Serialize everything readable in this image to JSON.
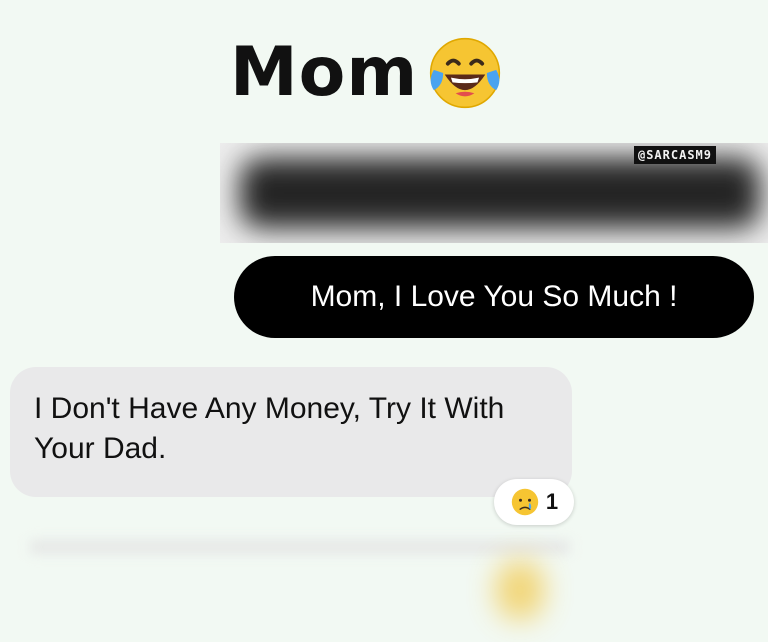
{
  "header": {
    "title": "Mom",
    "title_emoji": "face-with-tears-of-joy-icon"
  },
  "watermark": {
    "text": "@SARCASM9"
  },
  "messages": [
    {
      "direction": "outgoing",
      "text": "Mom, I Love You So Much !",
      "bubble_color": "#000000",
      "text_color": "#ffffff"
    },
    {
      "direction": "incoming",
      "text": "I Don't Have Any Money, Try It With Your Dad.",
      "bubble_color": "#e9e9ea",
      "text_color": "#111111",
      "reaction": {
        "emoji": "crying-face-icon",
        "count": "1"
      }
    }
  ],
  "colors": {
    "background": "#f2f9f3",
    "emoji_yellow": "#f6c532",
    "tear_blue": "#4aa3f0"
  }
}
